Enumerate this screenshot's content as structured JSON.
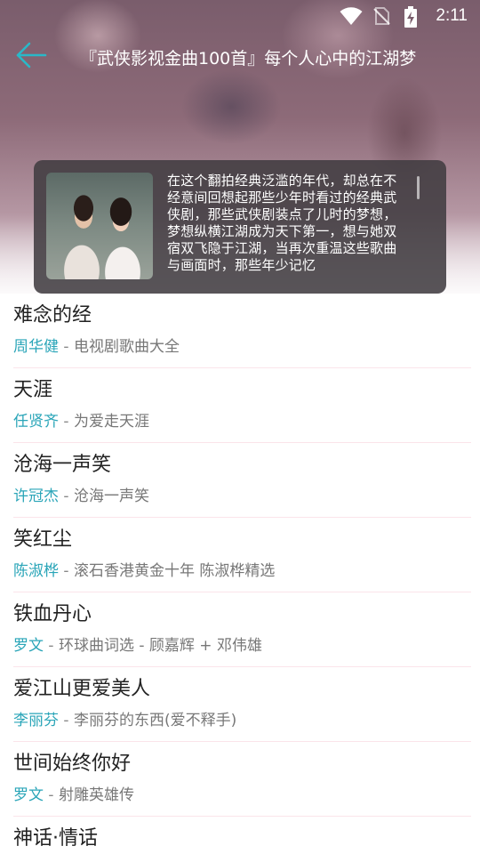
{
  "status_bar": {
    "time": "2:11",
    "icons": [
      "wifi-icon",
      "no-sim-icon",
      "battery-charging-icon"
    ]
  },
  "header": {
    "back_icon": "back-arrow-icon",
    "title": "『武侠影视金曲100首』每个人心中的江湖梦",
    "accent_color": "#2ab8c8"
  },
  "intro": {
    "text": "在这个翻拍经典泛滥的年代，却总在不经意间回想起那些少年时看过的经典武侠剧，那些武侠剧装点了儿时的梦想，梦想纵横江湖成为天下第一，想与她双宿双飞隐于江湖，当再次重温这些歌曲与画面时，那些年少记忆"
  },
  "songs": [
    {
      "title": "难念的经",
      "artist": "周华健",
      "sep": " - ",
      "album": "电视剧歌曲大全"
    },
    {
      "title": "天涯",
      "artist": "任贤齐",
      "sep": " - ",
      "album": "为爱走天涯"
    },
    {
      "title": "沧海一声笑",
      "artist": "许冠杰",
      "sep": " - ",
      "album": "沧海一声笑"
    },
    {
      "title": "笑红尘",
      "artist": "陈淑桦",
      "sep": " - ",
      "album": "滚石香港黄金十年 陈淑桦精选"
    },
    {
      "title": "铁血丹心",
      "artist": "罗文",
      "sep": " - ",
      "album": "环球曲词选 - 顾嘉辉 + 邓伟雄"
    },
    {
      "title": "爱江山更爱美人",
      "artist": "李丽芬",
      "sep": " - ",
      "album": "李丽芬的东西(爱不释手)"
    },
    {
      "title": "世间始终你好",
      "artist": "罗文",
      "sep": " - ",
      "album": "射雕英雄传"
    },
    {
      "title": "神话·情话",
      "artist": "",
      "sep": "",
      "album": ""
    }
  ],
  "colors": {
    "artist": "#2aa5b8",
    "divider": "#fbe4ea",
    "card_bg": "#413c41"
  }
}
